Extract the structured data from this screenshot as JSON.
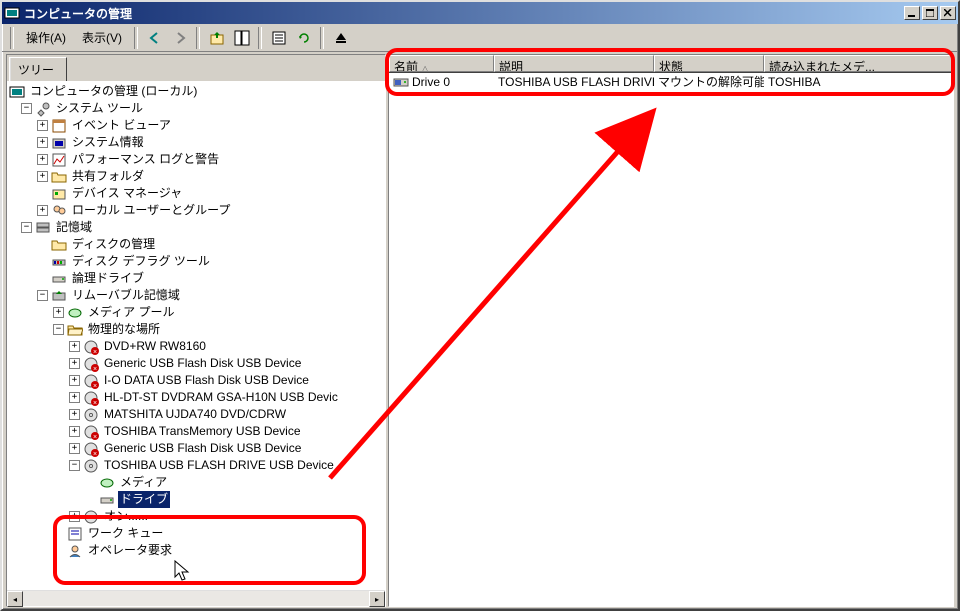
{
  "window": {
    "title": "コンピュータの管理"
  },
  "menu": {
    "action": "操作(A)",
    "view": "表示(V)"
  },
  "left": {
    "tab": "ツリー"
  },
  "tree": {
    "root": "コンピュータの管理 (ローカル)",
    "systools": "システム ツール",
    "eventviewer": "イベント ビューア",
    "sysinfo": "システム情報",
    "perflog": "パフォーマンス ログと警告",
    "shared": "共有フォルダ",
    "devmgr": "デバイス マネージャ",
    "localusr": "ローカル ユーザーとグループ",
    "storage": "記憶域",
    "diskmgmt": "ディスクの管理",
    "defrag": "ディスク デフラグ ツール",
    "logical": "論理ドライブ",
    "removable": "リムーバブル記憶域",
    "mediapool": "メディア プール",
    "physloc": "物理的な場所",
    "dev1": "DVD+RW RW8160",
    "dev2": "Generic USB Flash Disk USB Device",
    "dev3": "I-O DATA USB Flash Disk USB Device",
    "dev4": "HL-DT-ST DVDRAM GSA-H10N USB Devic",
    "dev5": "MATSHITA UJDA740 DVD/CDRW",
    "dev6": "TOSHIBA TransMemory USB Device",
    "dev7": "Generic USB Flash Disk USB Device",
    "dev8": "TOSHIBA USB FLASH DRIVE USB Device",
    "media": "メディア",
    "drive": "ドライブ",
    "obscured": "オン......",
    "workqueue": "ワーク キュー",
    "operator": "オペレータ要求"
  },
  "list": {
    "col_name": "名前",
    "col_desc": "説明",
    "col_state": "状態",
    "col_loaded": "読み込まれたメデ...",
    "row": {
      "name": "Drive 0",
      "desc": "TOSHIBA USB FLASH DRIVE ...",
      "state": "マウントの解除可能",
      "loaded": "TOSHIBA"
    }
  },
  "colors": {
    "titlebar_start": "#0a246a",
    "titlebar_end": "#a6caf0",
    "accent_red": "#ff0000",
    "selection": "#0a246a"
  }
}
